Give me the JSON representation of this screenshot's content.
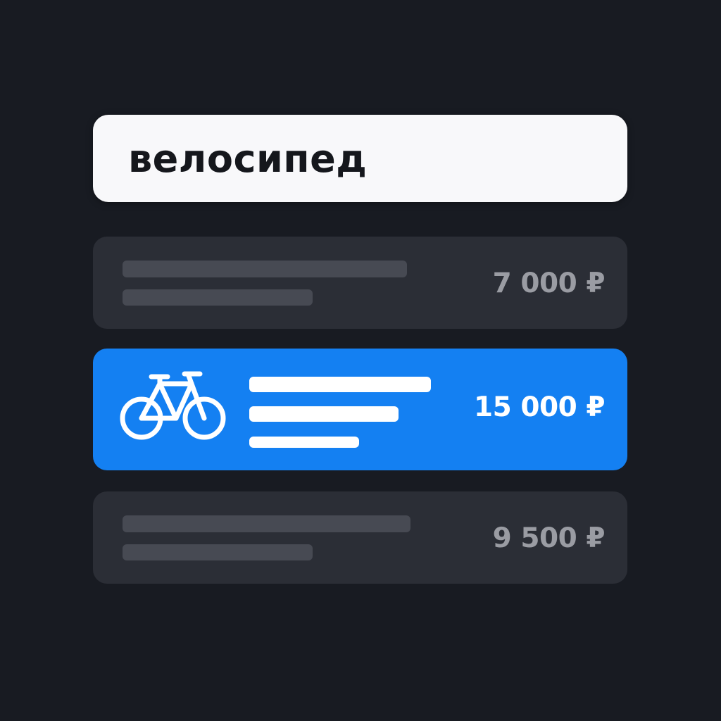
{
  "search": {
    "query": "велосипед",
    "button_icon": "search-icon"
  },
  "results": [
    {
      "price": "7 000 ₽",
      "selected": false
    },
    {
      "price": "15 000 ₽",
      "selected": true,
      "icon": "bicycle-icon"
    },
    {
      "price": "9 500 ₽",
      "selected": false
    }
  ],
  "colors": {
    "background": "#181b22",
    "accent": "#1480f2",
    "card": "#2b2e36",
    "placeholder_bar": "#474a53",
    "muted_text": "#9a9ca3"
  }
}
